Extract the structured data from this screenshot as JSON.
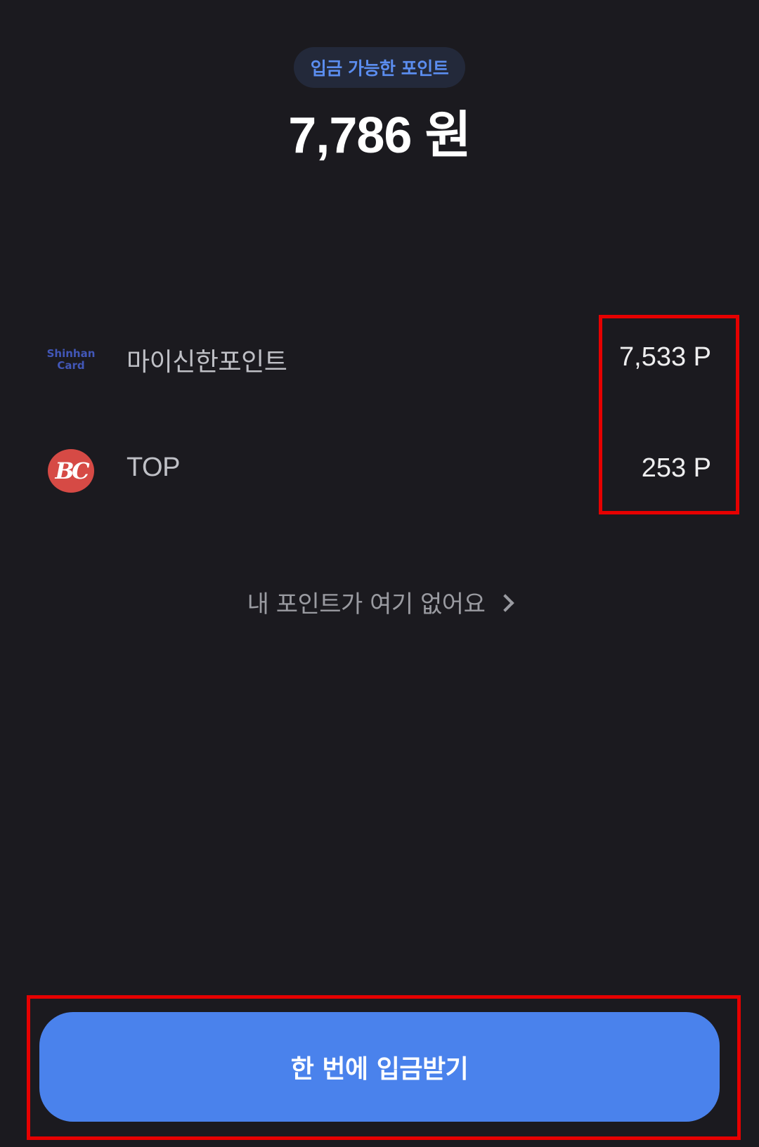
{
  "header": {
    "badge_label": "입금 가능한 포인트",
    "total_amount": "7,786 원"
  },
  "point_sources": [
    {
      "logo": {
        "icon": "shinhan-card-logo",
        "line1": "Shinhan",
        "line2": "Card",
        "color": "#4257b8"
      },
      "name": "마이신한포인트",
      "points": "7,533 P"
    },
    {
      "logo": {
        "icon": "bc-card-logo",
        "text": "BC",
        "color": "#d64a45"
      },
      "name": "TOP",
      "points": "253 P"
    }
  ],
  "missing_points_link": {
    "label": "내 포인트가 여기 없어요",
    "icon": "chevron-right-icon"
  },
  "cta": {
    "label": "한 번에 입금받기",
    "color": "#4a82ec"
  },
  "colors": {
    "background": "#1b1a1f",
    "badge_bg": "#23293a",
    "badge_text": "#5b8def",
    "highlight": "#e60000"
  }
}
